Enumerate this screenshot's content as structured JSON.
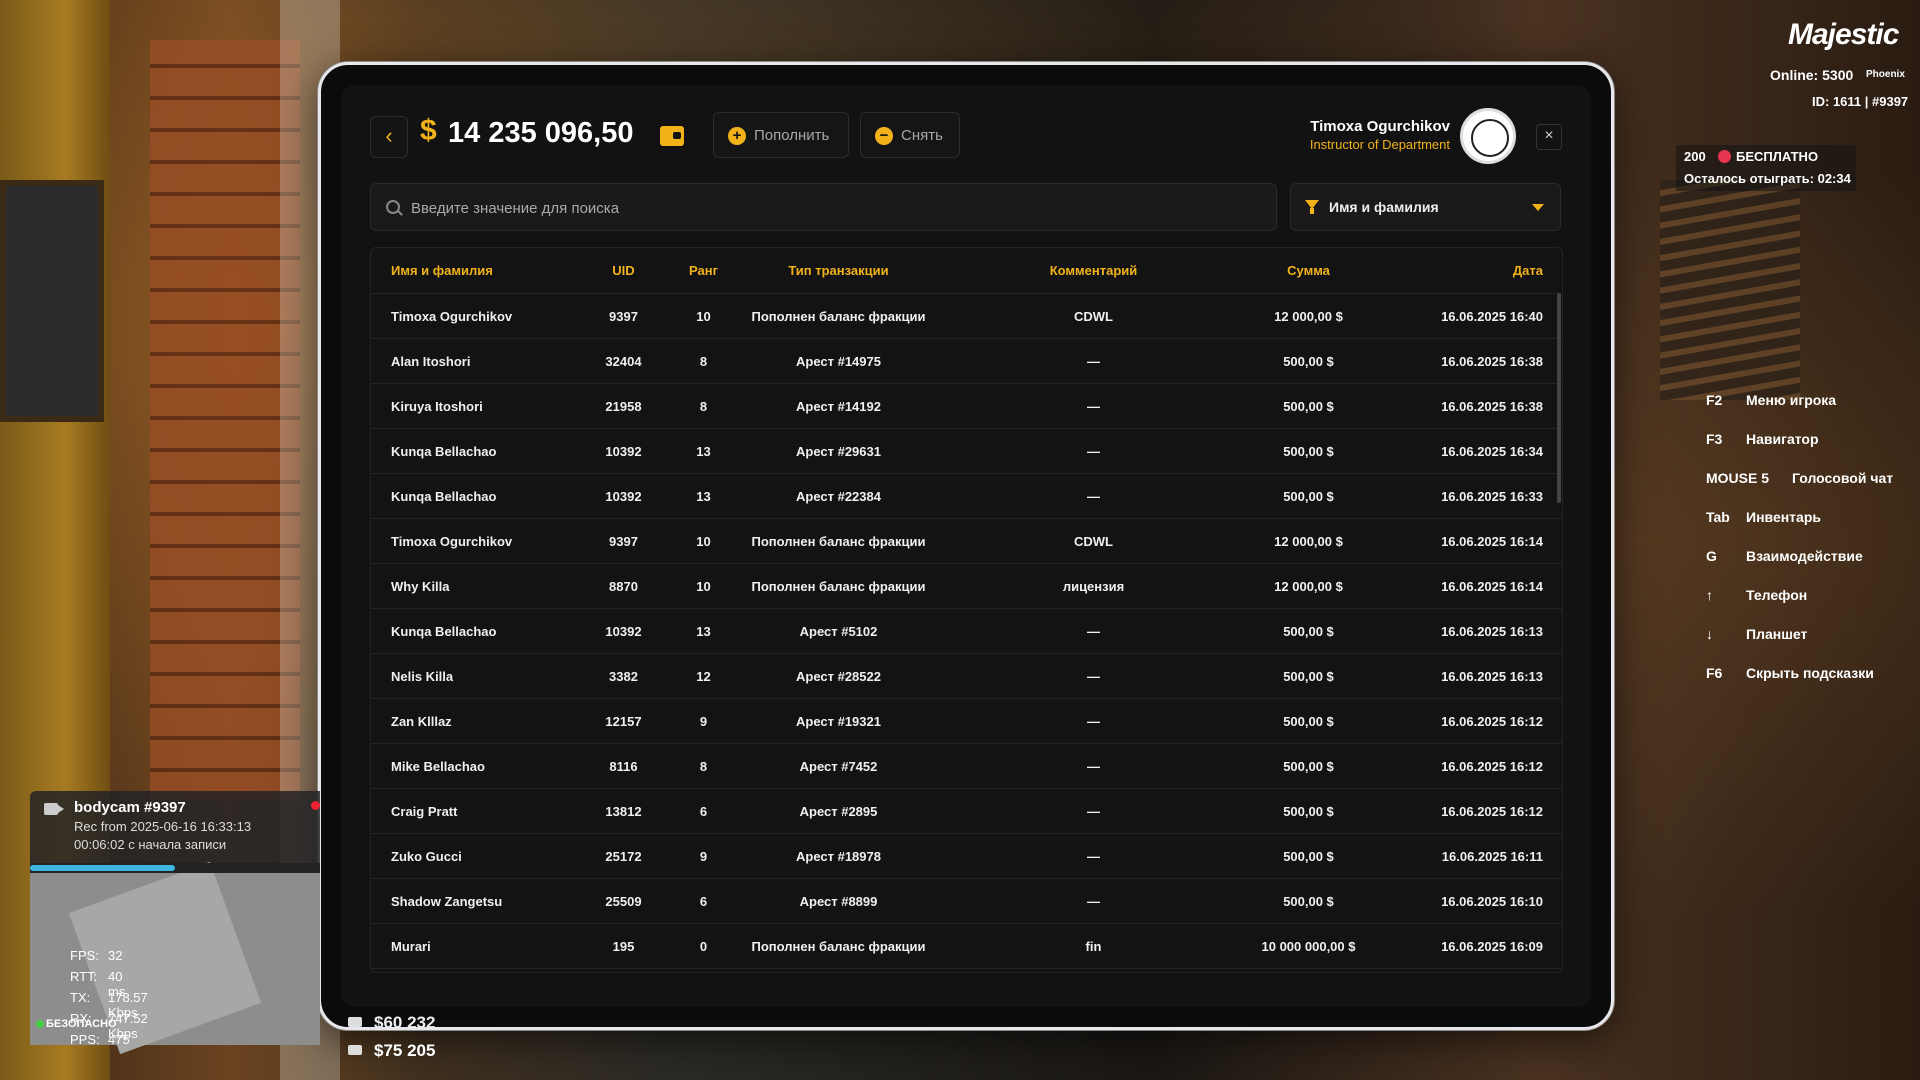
{
  "balance": {
    "currency": "$",
    "amount": "14 235 096,50"
  },
  "actions": {
    "deposit": "Пополнить",
    "withdraw": "Снять"
  },
  "user": {
    "name": "Timoxa Ogurchikov",
    "role": "Instructor of Department"
  },
  "search": {
    "placeholder": "Введите значение для поиска"
  },
  "filter": {
    "label": "Имя и фамилия"
  },
  "table": {
    "headers": [
      "Имя и фамилия",
      "UID",
      "Ранг",
      "Тип транзакции",
      "Комментарий",
      "Сумма",
      "Дата"
    ],
    "rows": [
      [
        "Timoxa Ogurchikov",
        "9397",
        "10",
        "Пополнен баланс фракции",
        "CDWL",
        "12 000,00 $",
        "16.06.2025 16:40"
      ],
      [
        "Alan Itoshori",
        "32404",
        "8",
        "Арест #14975",
        "—",
        "500,00 $",
        "16.06.2025 16:38"
      ],
      [
        "Kiruya Itoshori",
        "21958",
        "8",
        "Арест #14192",
        "—",
        "500,00 $",
        "16.06.2025 16:38"
      ],
      [
        "Kunqa Bellachao",
        "10392",
        "13",
        "Арест #29631",
        "—",
        "500,00 $",
        "16.06.2025 16:34"
      ],
      [
        "Kunqa Bellachao",
        "10392",
        "13",
        "Арест #22384",
        "—",
        "500,00 $",
        "16.06.2025 16:33"
      ],
      [
        "Timoxa Ogurchikov",
        "9397",
        "10",
        "Пополнен баланс фракции",
        "CDWL",
        "12 000,00 $",
        "16.06.2025 16:14"
      ],
      [
        "Why Killa",
        "8870",
        "10",
        "Пополнен баланс фракции",
        "лицензия",
        "12 000,00 $",
        "16.06.2025 16:14"
      ],
      [
        "Kunqa Bellachao",
        "10392",
        "13",
        "Арест #5102",
        "—",
        "500,00 $",
        "16.06.2025 16:13"
      ],
      [
        "Nelis Killa",
        "3382",
        "12",
        "Арест #28522",
        "—",
        "500,00 $",
        "16.06.2025 16:13"
      ],
      [
        "Zan Klllaz",
        "12157",
        "9",
        "Арест #19321",
        "—",
        "500,00 $",
        "16.06.2025 16:12"
      ],
      [
        "Mike Bellachao",
        "8116",
        "8",
        "Арест #7452",
        "—",
        "500,00 $",
        "16.06.2025 16:12"
      ],
      [
        "Craig Pratt",
        "13812",
        "6",
        "Арест #2895",
        "—",
        "500,00 $",
        "16.06.2025 16:12"
      ],
      [
        "Zuko Gucci",
        "25172",
        "9",
        "Арест #18978",
        "—",
        "500,00 $",
        "16.06.2025 16:11"
      ],
      [
        "Shadow Zangetsu",
        "25509",
        "6",
        "Арест #8899",
        "—",
        "500,00 $",
        "16.06.2025 16:10"
      ],
      [
        "Murari",
        "195",
        "0",
        "Пополнен баланс фракции",
        "fin",
        "10 000 000,00 $",
        "16.06.2025 16:09"
      ]
    ]
  },
  "hud": {
    "logo": "Majestic",
    "online_label": "Online:",
    "online_value": "5300",
    "server": "Phoenix",
    "id_line": "ID: 1611 | #9397",
    "promo_count": "200",
    "promo_label": "БЕСПЛАТНО",
    "promo_remaining": "Осталось отыграть: 02:34",
    "hints": [
      {
        "key": "F2",
        "label": "Меню игрока"
      },
      {
        "key": "F3",
        "label": "Навигатор"
      },
      {
        "key": "MOUSE 5",
        "label": "Голосовой чат"
      },
      {
        "key": "Tab",
        "label": "Инвентарь"
      },
      {
        "key": "G",
        "label": "Взаимодействие"
      },
      {
        "key": "↑",
        "label": "Телефон"
      },
      {
        "key": "↓",
        "label": "Планшет"
      },
      {
        "key": "F6",
        "label": "Скрыть подсказки"
      }
    ]
  },
  "bodycam": {
    "title": "bodycam #9397",
    "rec": "Rec from 2025-06-16 16:33:13",
    "elapsed": "00:06:02 с начала записи",
    "progress": 0.5
  },
  "netstats": [
    {
      "k": "FPS:",
      "v": "32"
    },
    {
      "k": "RTT:",
      "v": "40 ms"
    },
    {
      "k": "TX:",
      "v": "178.57 Kbps"
    },
    {
      "k": "RX:",
      "v": "747.52 Kbps"
    },
    {
      "k": "PPS:",
      "v": "475"
    }
  ],
  "safe_zone": "БЕЗОПАСНО",
  "cash": {
    "top": "$60 232",
    "bank": "$75 205"
  },
  "colors": {
    "accent": "#f2b21a",
    "panel": "#121213",
    "text": "#ffffff"
  }
}
